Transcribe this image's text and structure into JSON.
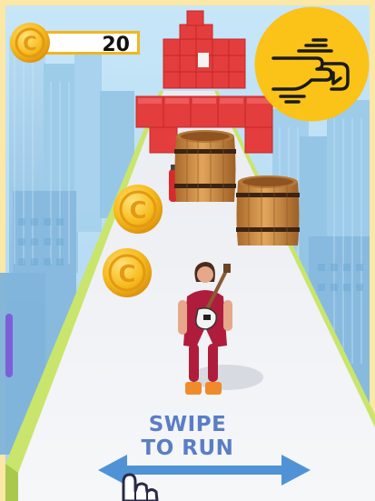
{
  "hud": {
    "coin_count": "20",
    "coin_icon": "coin-icon",
    "no_ads_icon": "no-ads-hand-icon"
  },
  "tutorial": {
    "line1": "SWIPE",
    "line2": "TO RUN",
    "arrow_icon": "double-arrow-icon",
    "hand_icon": "pointing-hand-icon"
  },
  "colors": {
    "sky": "#bfe1f5",
    "frame": "#fbe7a6",
    "track": "#f1f2f5",
    "track_edge": "#c9e56c",
    "coin": "#f5b81b",
    "crate": "#e23b3b",
    "barrel": "#c9863a",
    "runner_outfit": "#b01d3c",
    "text_blue": "#5a7ec4",
    "ad_badge": "#fbc218"
  }
}
